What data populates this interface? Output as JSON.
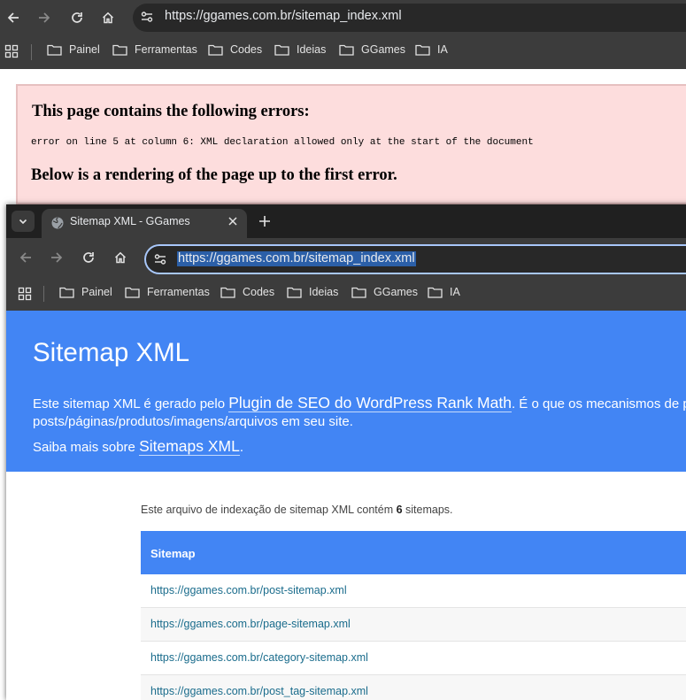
{
  "back_window": {
    "url": "https://ggames.com.br/sitemap_index.xml",
    "bookmarks": [
      "Painel",
      "Ferramentas",
      "Codes",
      "Ideias",
      "GGames",
      "IA"
    ],
    "error": {
      "title": "This page contains the following errors:",
      "message": "error on line 5 at column 6: XML declaration allowed only at the start of the document",
      "below": "Below is a rendering of the page up to the first error."
    }
  },
  "front_window": {
    "tab_title": "Sitemap XML - GGames",
    "url": "https://ggames.com.br/sitemap_index.xml",
    "bookmarks": [
      "Painel",
      "Ferramentas",
      "Codes",
      "Ideias",
      "GGames",
      "IA"
    ]
  },
  "page": {
    "title": "Sitemap XML",
    "intro_prefix": "Este sitemap XML é gerado pelo ",
    "intro_link": "Plugin de SEO do WordPress Rank Math",
    "intro_suffix": ". É o que os mecanismos de pes",
    "intro_line2": "posts/páginas/produtos/imagens/arquivos em seu site.",
    "learn_prefix": "Saiba mais sobre ",
    "learn_link": "Sitemaps XML",
    "learn_suffix": ".",
    "summary_prefix": "Este arquivo de indexação de sitemap XML contém ",
    "summary_count": "6",
    "summary_suffix": " sitemaps.",
    "table_header": "Sitemap",
    "sitemaps": [
      "https://ggames.com.br/post-sitemap.xml",
      "https://ggames.com.br/page-sitemap.xml",
      "https://ggames.com.br/category-sitemap.xml",
      "https://ggames.com.br/post_tag-sitemap.xml"
    ]
  },
  "colors": {
    "hero": "#4285f4",
    "error_bg": "#fddddd",
    "chrome_dark": "#3c3c3c",
    "link": "#1a6c8c"
  }
}
